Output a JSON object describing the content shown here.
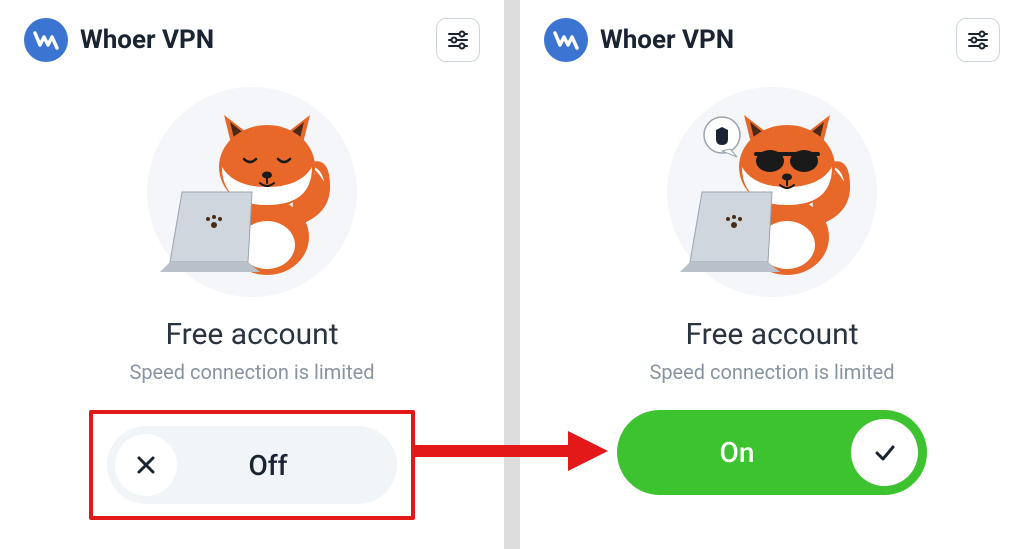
{
  "left": {
    "app_title": "Whoer VPN",
    "account_title": "Free account",
    "account_sub": "Speed connection is limited",
    "toggle_label": "Off"
  },
  "right": {
    "app_title": "Whoer VPN",
    "account_title": "Free account",
    "account_sub": "Speed connection is limited",
    "toggle_label": "On"
  }
}
